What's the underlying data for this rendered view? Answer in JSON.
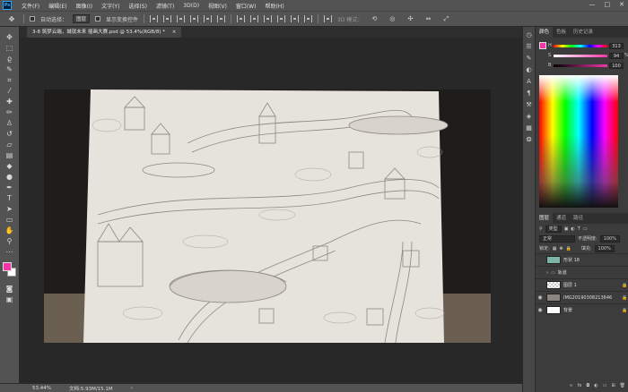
{
  "menubar": {
    "logo": "Ps",
    "items": [
      "文件(F)",
      "编辑(E)",
      "图像(I)",
      "文字(Y)",
      "选择(S)",
      "滤镜(T)",
      "3D(D)",
      "视图(V)",
      "窗口(W)",
      "帮助(H)"
    ],
    "window_controls": [
      "—",
      "□",
      "✕"
    ]
  },
  "options": {
    "auto_select_label": "自动选择：",
    "auto_select_value": "图层",
    "show_transform_label": "显示变换控件",
    "mode_label": "3D 模式："
  },
  "document": {
    "tab_title": "3-8 筑梦云端，城就未来 插画大赛.psd @ 53.4%(RGB/8) *",
    "tab_close": "×"
  },
  "status": {
    "zoom": "53.44%",
    "doc_size": "文档:5.93M/15.1M",
    "arrow": "›"
  },
  "color_panel": {
    "tabs": [
      "颜色",
      "色板",
      "历史记录"
    ],
    "channels": [
      {
        "label": "H",
        "value": "313"
      },
      {
        "label": "S",
        "value": "94"
      },
      {
        "label": "B",
        "value": "100"
      }
    ],
    "unit": "%"
  },
  "layers_panel": {
    "tabs": [
      "图层",
      "通道",
      "路径"
    ],
    "filter_label": "类型",
    "blend_mode": "正常",
    "opacity_label": "不透明度:",
    "opacity_value": "100%",
    "lock_label": "锁定:",
    "fill_label": "填充:",
    "fill_value": "100%",
    "layers": [
      {
        "name": "形状 18",
        "visible": false,
        "locked": false
      },
      {
        "name": "轨道",
        "visible": false,
        "locked": false
      },
      {
        "name": "图层 1",
        "visible": false,
        "locked": true
      },
      {
        "name": "IMG20190308213646",
        "visible": true,
        "locked": true
      },
      {
        "name": "背景",
        "visible": true,
        "locked": true
      }
    ]
  },
  "colors": {
    "foreground": "#f236a8",
    "background": "#ffffff",
    "accent": "#31a8ff"
  },
  "tools": [
    "move-icon",
    "marquee-icon",
    "lasso-icon",
    "quick-select-icon",
    "crop-icon",
    "eyedropper-icon",
    "healing-icon",
    "brush-icon",
    "stamp-icon",
    "history-brush-icon",
    "eraser-icon",
    "gradient-icon",
    "blur-icon",
    "dodge-icon",
    "pen-icon",
    "type-icon",
    "path-select-icon",
    "shape-icon",
    "hand-icon",
    "zoom-icon"
  ]
}
